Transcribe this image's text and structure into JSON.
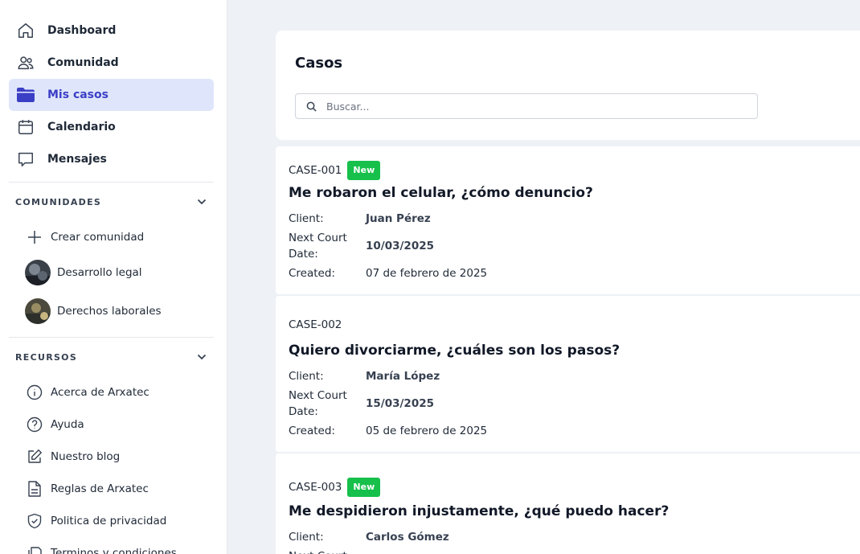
{
  "sidebar": {
    "nav": [
      {
        "label": "Dashboard",
        "icon": "home-icon"
      },
      {
        "label": "Comunidad",
        "icon": "users-icon"
      },
      {
        "label": "Mis casos",
        "icon": "folder-icon",
        "active": true
      },
      {
        "label": "Calendario",
        "icon": "calendar-icon"
      },
      {
        "label": "Mensajes",
        "icon": "message-icon"
      }
    ],
    "communities": {
      "title": "COMUNIDADES",
      "create_label": "Crear comunidad",
      "items": [
        {
          "label": "Desarrollo legal"
        },
        {
          "label": "Derechos laborales"
        }
      ]
    },
    "resources": {
      "title": "RECURSOS",
      "items": [
        {
          "label": "Acerca de Arxatec",
          "icon": "info-icon"
        },
        {
          "label": "Ayuda",
          "icon": "help-icon"
        },
        {
          "label": "Nuestro blog",
          "icon": "edit-icon"
        },
        {
          "label": "Reglas de Arxatec",
          "icon": "document-icon"
        },
        {
          "label": "Politica de privacidad",
          "icon": "shield-icon"
        },
        {
          "label": "Terminos y condiciones",
          "icon": "file-icon"
        }
      ]
    }
  },
  "main": {
    "title": "Casos",
    "search_placeholder": "Buscar...",
    "labels": {
      "client": "Client:",
      "next_court_date": "Next Court Date:",
      "created": "Created:"
    },
    "cases": [
      {
        "id": "CASE-001",
        "badge": "New",
        "title": "Me robaron el celular, ¿cómo denuncio?",
        "client": "Juan Pérez",
        "next_court_date": "10/03/2025",
        "created": "07 de febrero de 2025"
      },
      {
        "id": "CASE-002",
        "badge": "",
        "title": "Quiero divorciarme, ¿cuáles son los pasos?",
        "client": "María López",
        "next_court_date": "15/03/2025",
        "created": "05 de febrero de 2025"
      },
      {
        "id": "CASE-003",
        "badge": "New",
        "title": "Me despidieron injustamente, ¿qué puedo hacer?",
        "client": "Carlos Gómez",
        "next_court_date": "",
        "created": ""
      }
    ]
  },
  "colors": {
    "accent": "#3b3fc6",
    "active_bg": "#dfe6fb",
    "badge_new": "#16c04a",
    "page_bg": "#eef1f6"
  }
}
